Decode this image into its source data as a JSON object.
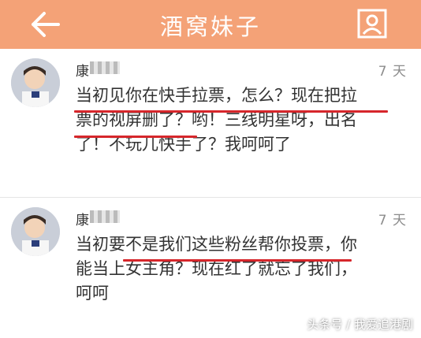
{
  "header": {
    "title": "酒窝妹子",
    "back_icon": "back-arrow-icon",
    "profile_icon": "profile-icon",
    "color": "#f4a277"
  },
  "comments": [
    {
      "name": "康",
      "time": "7 天",
      "lines": [
        "当初见你在快手拉票，怎么？现在把拉",
        "票的视屏删了？哟！三线明星呀，出名",
        "了！不玩儿快手了？我呵呵了"
      ]
    },
    {
      "name": "康",
      "time": "7 天",
      "lines": [
        "当初要不是我们这些粉丝帮你投票，你",
        "能当上女主角？现在红了就忘了我们，",
        "呵呵"
      ]
    }
  ],
  "highlight_color": "#d6262b",
  "watermark": "头条号 / 我爱追港剧"
}
